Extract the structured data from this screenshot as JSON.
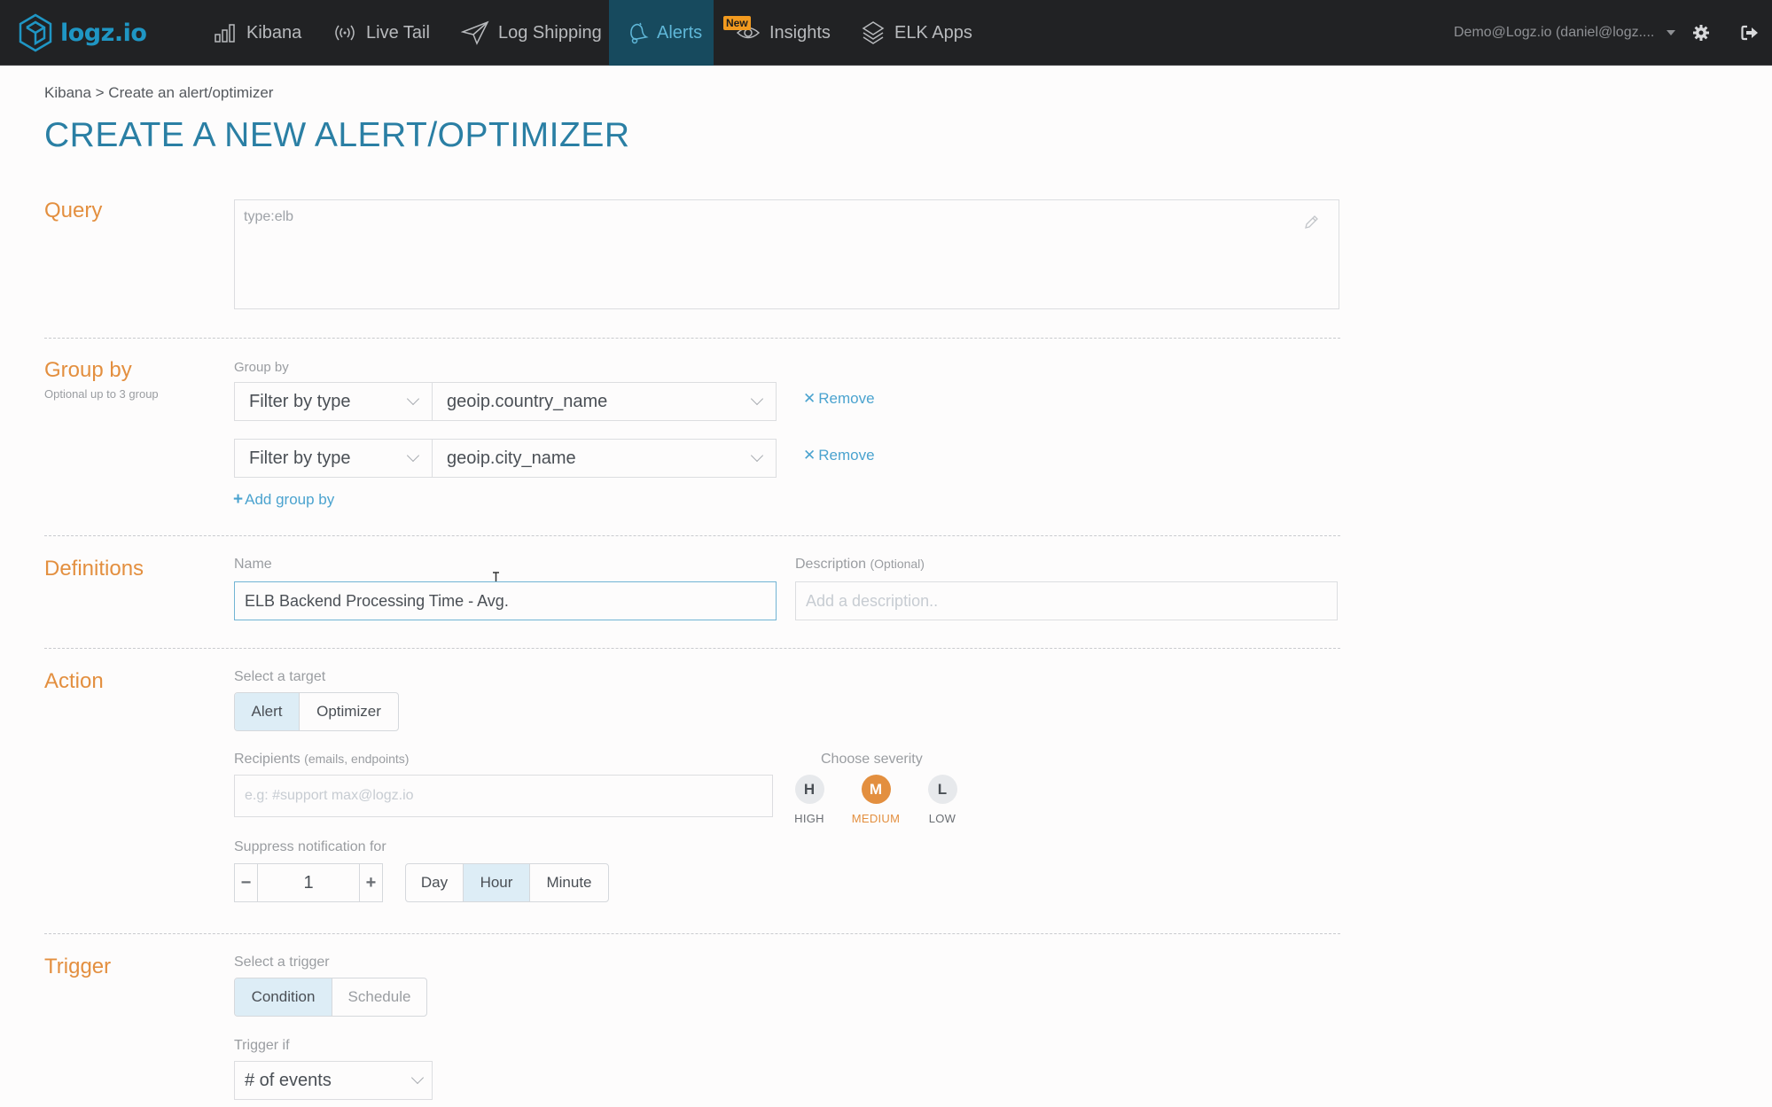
{
  "navbar": {
    "logo_text": "logz.io",
    "items": [
      {
        "label": "Kibana",
        "icon": "bar-chart-icon"
      },
      {
        "label": "Live Tail",
        "icon": "broadcast-icon"
      },
      {
        "label": "Log Shipping",
        "icon": "paper-plane-icon"
      },
      {
        "label": "Alerts",
        "icon": "bell-icon",
        "active": true
      },
      {
        "label": "Insights",
        "icon": "eye-icon",
        "badge": "New"
      },
      {
        "label": "ELK Apps",
        "icon": "layers-icon"
      }
    ],
    "user_label": "Demo@Logz.io (daniel@logz....",
    "colors": {
      "background": "#212224",
      "active_tab": "#174a5e",
      "accent": "#1f96c4",
      "badge": "#f29a1f"
    }
  },
  "breadcrumb": "Kibana > Create an alert/optimizer",
  "page_title": "CREATE A NEW ALERT/OPTIMIZER",
  "query": {
    "label": "Query",
    "value": "type:elb"
  },
  "group_by": {
    "label": "Group by",
    "sublabel": "Optional up to 3 group",
    "field_label": "Group by",
    "rows": [
      {
        "type": "Filter by type",
        "field": "geoip.country_name",
        "remove": "Remove"
      },
      {
        "type": "Filter by type",
        "field": "geoip.city_name",
        "remove": "Remove"
      }
    ],
    "add_label": "Add group by"
  },
  "definitions": {
    "label": "Definitions",
    "name_label": "Name",
    "name_value": "ELB Backend Processing Time - Avg.",
    "description_label": "Description",
    "description_hint": "(Optional)",
    "description_placeholder": "Add a description.."
  },
  "action": {
    "label": "Action",
    "target_label": "Select a target",
    "targets": [
      {
        "label": "Alert",
        "selected": true
      },
      {
        "label": "Optimizer",
        "selected": false
      }
    ],
    "recipients_label": "Recipients",
    "recipients_hint": "(emails, endpoints)",
    "recipients_placeholder": "e.g:  #support  max@logz.io",
    "severity_label": "Choose severity",
    "severities": [
      {
        "letter": "H",
        "label": "HIGH",
        "selected": false
      },
      {
        "letter": "M",
        "label": "MEDIUM",
        "selected": true
      },
      {
        "letter": "L",
        "label": "LOW",
        "selected": false
      }
    ],
    "suppress_label": "Suppress notification for",
    "suppress_value": "1",
    "suppress_minus": "−",
    "suppress_plus": "+",
    "suppress_units": [
      {
        "label": "Day",
        "selected": false
      },
      {
        "label": "Hour",
        "selected": true
      },
      {
        "label": "Minute",
        "selected": false
      }
    ]
  },
  "trigger": {
    "label": "Trigger",
    "select_label": "Select a trigger",
    "options": [
      {
        "label": "Condition",
        "selected": true
      },
      {
        "label": "Schedule",
        "selected": false
      }
    ],
    "trigger_if_label": "Trigger if",
    "trigger_if_value": "# of events"
  },
  "colors": {
    "section_label": "#e38f3f",
    "title": "#2a7fa4",
    "link": "#4ba3cf",
    "selected_segment": "#ddedf6",
    "severity_selected": "#e38f3f"
  }
}
